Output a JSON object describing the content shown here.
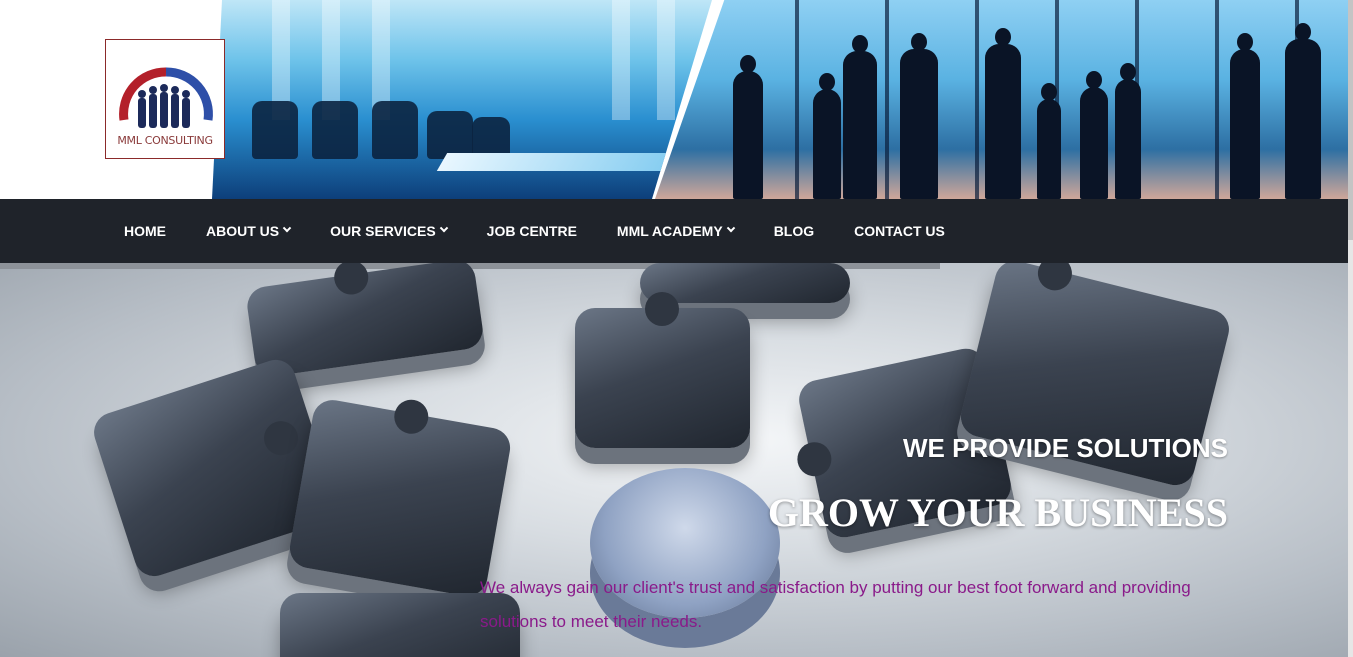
{
  "brand": {
    "logo_text": "MML CONSULTING",
    "colors": {
      "arc_red": "#b3202a",
      "arc_blue": "#2e4fa8",
      "text": "#8a3a3a"
    }
  },
  "nav": {
    "items": [
      {
        "label": "HOME",
        "has_dropdown": false
      },
      {
        "label": "ABOUT US",
        "has_dropdown": true
      },
      {
        "label": "OUR SERVICES",
        "has_dropdown": true
      },
      {
        "label": "JOB CENTRE",
        "has_dropdown": false
      },
      {
        "label": "MML ACADEMY",
        "has_dropdown": true
      },
      {
        "label": "BLOG",
        "has_dropdown": false
      },
      {
        "label": "CONTACT US",
        "has_dropdown": false
      }
    ],
    "dropdown_icon": "chevron-down-icon",
    "background": "#1f232a"
  },
  "hero": {
    "kicker": "WE PROVIDE SOLUTIONS",
    "title": "GROW YOUR BUSINESS",
    "description": "We always gain our client's trust and satisfaction by putting our best foot forward and providing solutions to meet their needs.",
    "description_color": "#8a1a8a"
  }
}
